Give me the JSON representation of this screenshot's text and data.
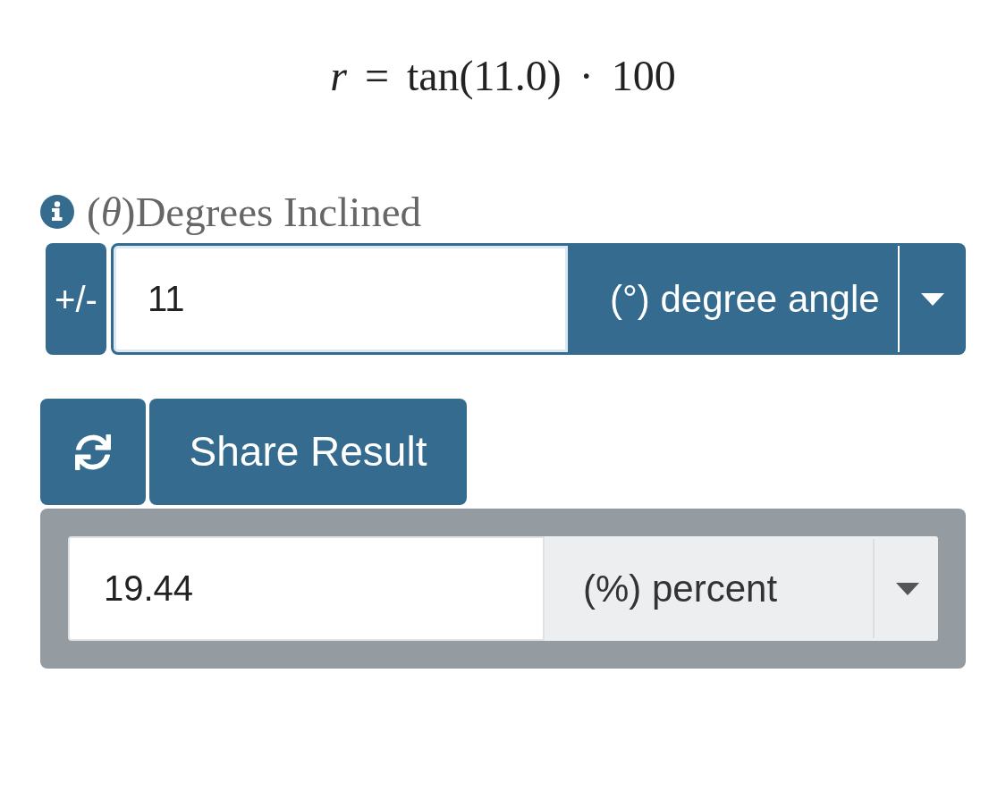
{
  "formula": "*r* = tan(11.0) · 100",
  "input": {
    "label": "(*θ*)Degrees Inclined",
    "sign_button": "+/-",
    "value": "11",
    "focused": true,
    "unit": "(°) degree angle"
  },
  "actions": {
    "share_button": "Share Result"
  },
  "result": {
    "value": "19.44",
    "focused": false,
    "unit": "(%) percent"
  }
}
